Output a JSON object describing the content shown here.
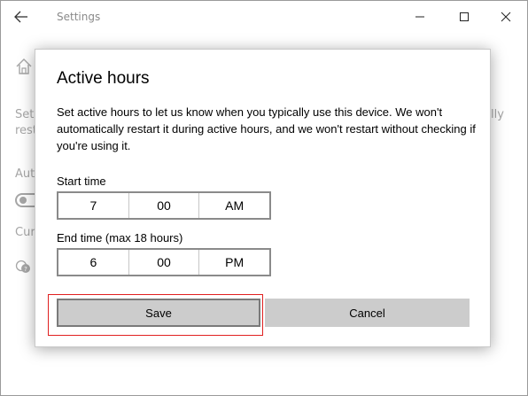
{
  "window": {
    "title": "Settings",
    "back_icon": "back-arrow-icon",
    "controls": [
      "minimize-icon",
      "maximize-icon",
      "close-icon"
    ]
  },
  "background": {
    "home_icon": "home-icon",
    "line1_left": "Set",
    "line1_right": "lly",
    "line2_left": "rest",
    "auto_label": "Aut",
    "cur_label": "Cur",
    "help_icon": "help-chat-icon"
  },
  "dialog": {
    "title": "Active hours",
    "description": "Set active hours to let us know when you typically use this device. We won't automatically restart it during active hours, and we won't restart without checking if you're using it.",
    "start_time": {
      "label": "Start time",
      "hour": "7",
      "minute": "00",
      "period": "AM"
    },
    "end_time": {
      "label": "End time (max 18 hours)",
      "hour": "6",
      "minute": "00",
      "period": "PM"
    },
    "save_label": "Save",
    "cancel_label": "Cancel"
  },
  "colors": {
    "focus_outline": "#e02020",
    "button_bg": "#cccccc"
  }
}
